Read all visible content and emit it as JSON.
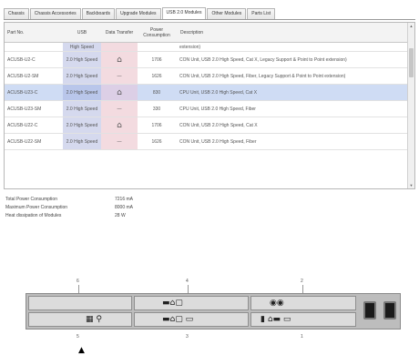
{
  "tabs": [
    {
      "label": "Chassis",
      "active": false
    },
    {
      "label": "Chassis Accessories",
      "active": false
    },
    {
      "label": "Backboards",
      "active": false
    },
    {
      "label": "Upgrade Modules",
      "active": false
    },
    {
      "label": "USB 2.0 Modules",
      "active": true
    },
    {
      "label": "Other Modules",
      "active": false
    },
    {
      "label": "Parts List",
      "active": false
    }
  ],
  "table": {
    "headers": {
      "part_no": "Part No.",
      "usb": "USB",
      "data_transfer": "Data Transfer",
      "power": "Power Consumption",
      "description": "Description"
    },
    "top_partial": {
      "usb": "High Speed",
      "description": "extension)"
    },
    "rows": [
      {
        "part_no": "ACUSB-U2-C",
        "usb": "2.0 High Speed",
        "data_icon": "cart-icon",
        "data_text": "",
        "power": "1706",
        "description": "CON Unit, USB 2.0 High Speed, Cat X, Legacy Support & Point to Point extension)",
        "selected": false
      },
      {
        "part_no": "ACUSB-U2-SM",
        "usb": "2.0 High Speed",
        "data_icon": "",
        "data_text": "—",
        "power": "1626",
        "description": "CON Unit, USB 2.0 High Speed, Fiber, Legacy Support & Point to Point extension)",
        "selected": false
      },
      {
        "part_no": "ACUSB-U23-C",
        "usb": "2.0 High Speed",
        "data_icon": "cart-icon",
        "data_text": "",
        "power": "830",
        "description": "CPU Unit, USB 2.0 High Speed, Cat X",
        "selected": true
      },
      {
        "part_no": "ACUSB-U23-SM",
        "usb": "2.0 High Speed",
        "data_icon": "",
        "data_text": "—",
        "power": "330",
        "description": "CPU Unit, USB 2.0 High Speed, Fiber",
        "selected": false
      },
      {
        "part_no": "ACUSB-U22-C",
        "usb": "2.0 High Speed",
        "data_icon": "cart-icon",
        "data_text": "",
        "power": "1706",
        "description": "CON Unit, USB 2.0 High Speed, Cat X",
        "selected": false
      },
      {
        "part_no": "ACUSB-U22-SM",
        "usb": "2.0 High Speed",
        "data_icon": "",
        "data_text": "—",
        "power": "1626",
        "description": "CON Unit, USB 2.0 High Speed, Fiber",
        "selected": false
      }
    ]
  },
  "summary": [
    {
      "label": "Total Power Consumption",
      "value": "7216 mA"
    },
    {
      "label": "Maximum Power Consumption",
      "value": "8000 mA"
    },
    {
      "label": "Heat dissipation of Modules",
      "value": "28 W"
    }
  ],
  "diagram": {
    "callouts": [
      "6",
      "4",
      "2",
      "5",
      "3",
      "1"
    ],
    "psu_color": "#1a1a1a",
    "chassis_color": "#bdbdbd"
  },
  "colors": {
    "usb_column": "#d5d9ee",
    "data_column": "#f3dbe0",
    "selected_row": "#cfdcf4"
  }
}
